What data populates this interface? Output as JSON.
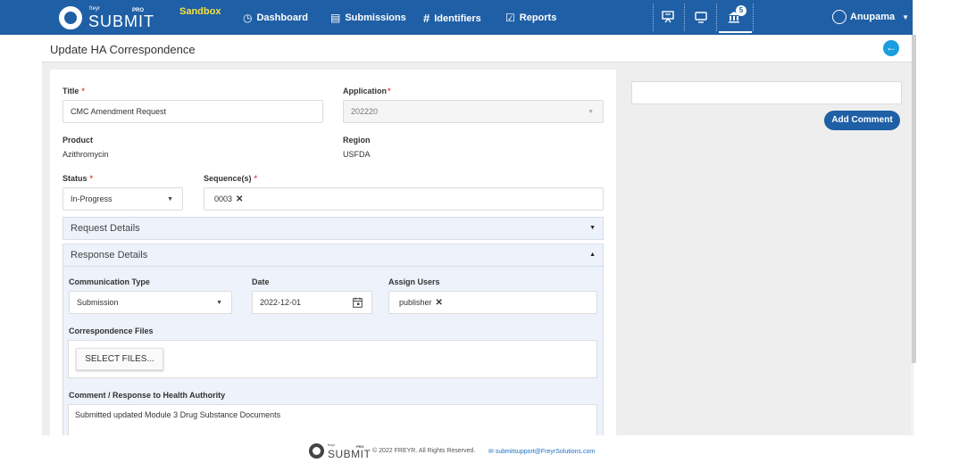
{
  "app": {
    "brand_small": "freyr",
    "brand": "SUBMIT",
    "brand_tag": "PRO",
    "environment": "Sandbox"
  },
  "nav": {
    "items": [
      {
        "label": "Dashboard",
        "icon": "clock-icon"
      },
      {
        "label": "Submissions",
        "icon": "document-icon"
      },
      {
        "label": "Identifiers",
        "icon": "hash-icon"
      },
      {
        "label": "Reports",
        "icon": "clipboard-check-icon"
      }
    ],
    "icons": [
      "presentation-icon",
      "monitor-icon",
      "bank-icon"
    ],
    "notification_count": "5",
    "user": "Anupama"
  },
  "page": {
    "title": "Update HA Correspondence"
  },
  "form": {
    "title_label": "Title",
    "title_value": "CMC Amendment Request",
    "application_label": "Application",
    "application_value": "202220",
    "product_label": "Product",
    "product_value": "Azithromycin",
    "region_label": "Region",
    "region_value": "USFDA",
    "status_label": "Status",
    "status_value": "In-Progress",
    "sequences_label": "Sequence(s)",
    "sequences": [
      "0003"
    ],
    "request_details": "Request Details",
    "response_details": "Response Details",
    "communication_type_label": "Communication Type",
    "communication_type_value": "Submission",
    "date_label": "Date",
    "date_value": "2022-12-01",
    "assign_users_label": "Assign Users",
    "assigned_users": [
      "publisher"
    ],
    "files_label": "Correspondence Files",
    "select_files": "SELECT FILES...",
    "comment_label": "Comment / Response to Health Authority",
    "comment_value": "Submitted updated Module 3 Drug Substance Documents"
  },
  "comments": {
    "add_button": "Add Comment"
  },
  "footer": {
    "brand_small": "freyr",
    "brand": "SUBMIT",
    "brand_tag": "PRO",
    "copyright": "© 2022 FREYR. All Rights Reserved.",
    "email": "submitsupport@FreyrSolutions.com"
  },
  "colors": {
    "primary": "#1f5fa6",
    "sandbox": "#f5e33b",
    "accent": "#1a9ee0",
    "required": "#d9534f",
    "panel": "#edf2fb"
  }
}
